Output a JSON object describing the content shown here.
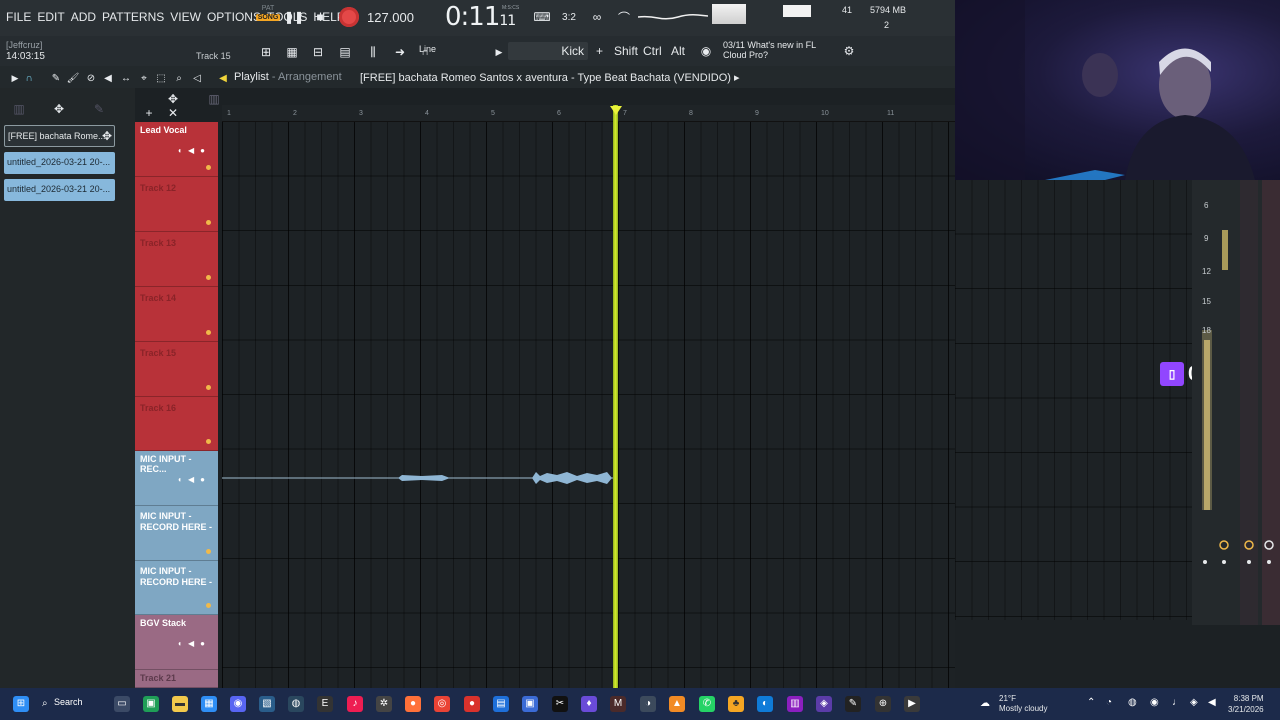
{
  "menu": [
    "FILE",
    "EDIT",
    "ADD",
    "PATTERNS",
    "VIEW",
    "OPTIONS",
    "TOOLS",
    "HELP"
  ],
  "transport": {
    "pat_label": "PAT",
    "song_label": "SONG",
    "tempo": "127.000",
    "clock_main": "0:11",
    "clock_sub": "11",
    "clock_unit": "M:S:CS"
  },
  "perf": {
    "cpu": "41",
    "memory": "5794 MB",
    "polyphony": "2"
  },
  "user": {
    "name": "[Jeffcruz]",
    "time": "14:03:15"
  },
  "toolbar": {
    "track_hint": "Track 15",
    "snap": "Line",
    "channel": "Kick",
    "plus": "+",
    "shift": "Shift",
    "ctrl": "Ctrl",
    "alt": "Alt",
    "news_date": "03/11",
    "news_text_1": "What's new in FL",
    "news_text_2": "Cloud Pro?"
  },
  "playlist": {
    "label": "Playlist",
    "sep": "-",
    "sublabel": "Arrangement",
    "song_title": "[FREE] bachata Romeo Santos x aventura - Type Beat Bachata (VENDIDO)",
    "arrow": "▸"
  },
  "patterns": [
    "[FREE] bachata Rome...",
    "untitled_2026-03-21 20-...",
    "untitled_2026-03-21 20-..."
  ],
  "ruler": [
    "1",
    "2",
    "3",
    "4",
    "5",
    "6",
    "7",
    "8",
    "9",
    "10",
    "11"
  ],
  "tracks": {
    "lead_vocal": "Lead Vocal",
    "t12": "Track 12",
    "t13": "Track 13",
    "t14": "Track 14",
    "t15": "Track 15",
    "t16": "Track 16",
    "mic_input": "MIC INPUT - REC...",
    "mic_rec_a": "MIC INPUT - RECORD HERE -",
    "mic_rec_b": "MIC INPUT - RECORD HERE -",
    "bgv": "BGV Stack",
    "t21": "Track 21"
  },
  "twitch": {
    "count": "0"
  },
  "mixer_scale": [
    "6",
    "9",
    "12",
    "15",
    "18"
  ],
  "taskbar": {
    "search": "Search",
    "temp": "21°F",
    "weather": "Mostly cloudy",
    "time": "8:38 PM",
    "date": "3/21/2026"
  },
  "colors": {
    "accent": "#f5a623",
    "record": "#e44848",
    "playhead": "#d6ef2c",
    "track_red": "#b83239",
    "track_blue": "#7fa7c3",
    "track_pink": "#9a6a84",
    "twitch": "#9146ff"
  }
}
